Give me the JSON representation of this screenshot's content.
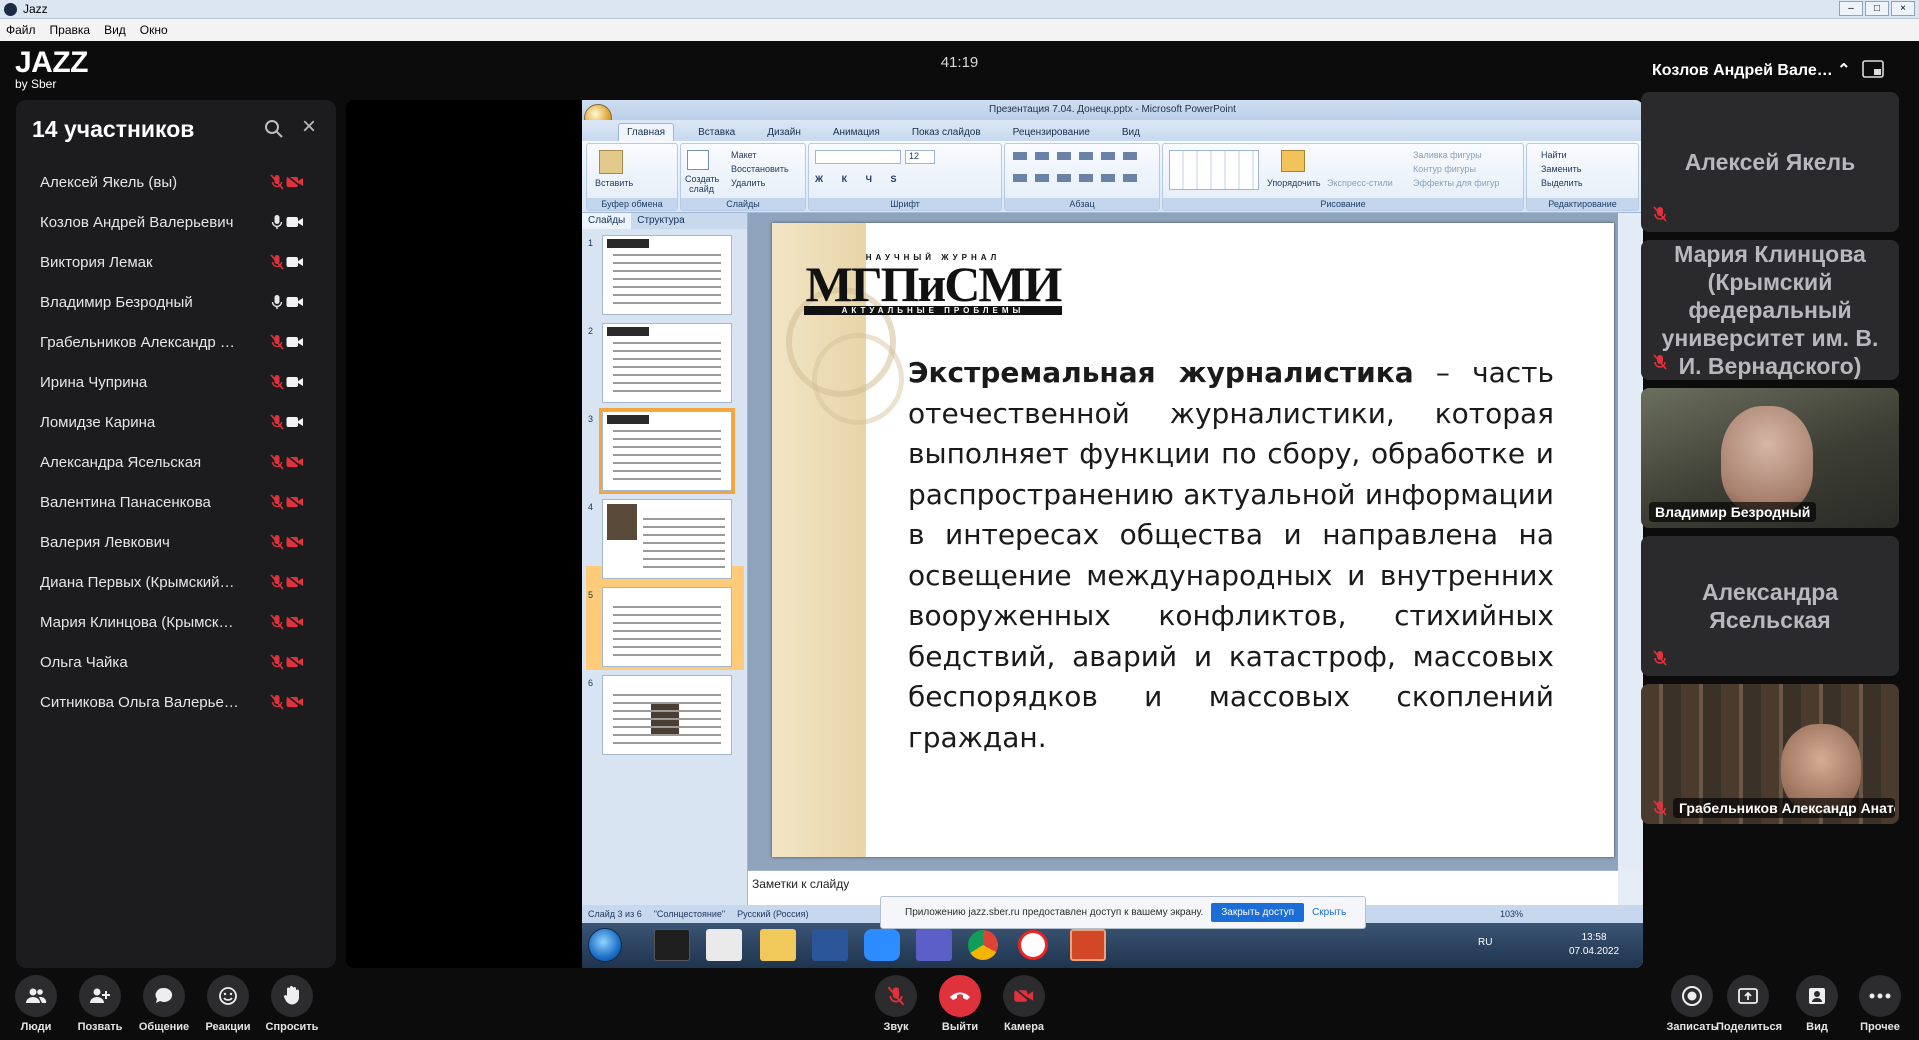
{
  "window": {
    "title": "Jazz",
    "menu": [
      "Файл",
      "Правка",
      "Вид",
      "Окно"
    ]
  },
  "brand": {
    "name": "JAZZ",
    "sub": "by Sber"
  },
  "timer": "41:19",
  "participants": {
    "title": "14 участников",
    "list": [
      {
        "name": "Алексей Якель (вы)",
        "mic": "off",
        "cam": "off"
      },
      {
        "name": "Козлов Андрей Валерьевич",
        "mic": "on",
        "cam": "on"
      },
      {
        "name": "Виктория Лемак",
        "mic": "off",
        "cam": "on"
      },
      {
        "name": "Владимир Безродный",
        "mic": "on",
        "cam": "on"
      },
      {
        "name": "Грабельников Александр …",
        "mic": "off",
        "cam": "on"
      },
      {
        "name": "Ирина Чуприна",
        "mic": "off",
        "cam": "on"
      },
      {
        "name": "Ломидзе Карина",
        "mic": "off",
        "cam": "on"
      },
      {
        "name": "Александра Ясельская",
        "mic": "off",
        "cam": "off"
      },
      {
        "name": "Валентина Панасенкова",
        "mic": "off",
        "cam": "off"
      },
      {
        "name": "Валерия Левкович",
        "mic": "off",
        "cam": "off"
      },
      {
        "name": "Диана Первых (Крымский…",
        "mic": "off",
        "cam": "off"
      },
      {
        "name": "Мария Клинцова (Крымск…",
        "mic": "off",
        "cam": "off"
      },
      {
        "name": "Ольга Чайка",
        "mic": "off",
        "cam": "off"
      },
      {
        "name": "Ситникова Ольга Валерье…",
        "mic": "off",
        "cam": "off"
      }
    ]
  },
  "ppt": {
    "title": "Презентация 7.04. Донецк.pptx - Microsoft PowerPoint",
    "tabs": [
      "Главная",
      "Вставка",
      "Дизайн",
      "Анимация",
      "Показ слайдов",
      "Рецензирование",
      "Вид"
    ],
    "groups": [
      "Буфер обмена",
      "Слайды",
      "Шрифт",
      "Абзац",
      "Рисование",
      "Редактирование"
    ],
    "ribbon_items": {
      "paste": "Вставить",
      "create": "Создать",
      "slide": "слайд",
      "layout": "Макет",
      "restore": "Восстановить",
      "delete": "Удалить",
      "arrange": "Упорядочить",
      "express": "Экспресс-стили",
      "fill": "Заливка фигуры",
      "outline": "Контур фигуры",
      "effects": "Эффекты для фигур",
      "find": "Найти",
      "replace": "Заменить",
      "select": "Выделить",
      "fontsize": "12"
    },
    "pane_tabs": [
      "Слайды",
      "Структура"
    ],
    "thumbs": [
      "1",
      "2",
      "3",
      "4",
      "5",
      "6"
    ],
    "slide": {
      "logo_top": "НАУЧНЫЙ ЖУРНАЛ",
      "logo_main": "МГПиСМИ",
      "logo_bottom": "АКТУАЛЬНЫЕ ПРОБЛЕМЫ",
      "bold": "Экстремальная журналистика",
      "text": " – часть отечественной журналистики, которая выполняет функции по сбору, обработке и распространению актуальной информации в интересах общества и направлена на освещение международных и внутренних вооруженных конфликтов, стихийных бедствий, аварий и катастроф, массовых беспорядков и массовых скоплений граждан."
    },
    "notes": "Заметки к слайду",
    "status": [
      "Слайд 3 из 6",
      "\"Солнцестояние\"",
      "Русский (Россия)"
    ],
    "zoom": "103%",
    "lang": "RU",
    "time": "13:58",
    "date": "07.04.2022"
  },
  "toast": {
    "text": "Приложению jazz.sber.ru предоставлен доступ к вашему экрану.",
    "btn": "Закрыть доступ",
    "hide": "Скрыть"
  },
  "speaker": {
    "name": "Козлов Андрей Вале…"
  },
  "tiles": [
    {
      "name": "Алексей Якель",
      "type": "text"
    },
    {
      "name": "Мария Клинцова (Крымский федеральный университет им. В. И. Вернадского)",
      "type": "text"
    },
    {
      "name": "Владимир Безродный",
      "type": "video"
    },
    {
      "name": "Александра Ясельская",
      "type": "text"
    },
    {
      "name": "Грабельников Александр Анатольевич",
      "type": "video"
    }
  ],
  "toolbar": {
    "left": [
      "Люди",
      "Позвать",
      "Общение",
      "Реакции",
      "Спросить"
    ],
    "center": [
      "Звук",
      "Выйти",
      "Камера"
    ],
    "right": [
      "Записать",
      "Поделиться",
      "Вид",
      "Прочее"
    ]
  },
  "colors": {
    "accent": "#e0323c",
    "bg": "#0c0c0d",
    "panel": "#1c1c1e",
    "muted": "#e0323c"
  }
}
